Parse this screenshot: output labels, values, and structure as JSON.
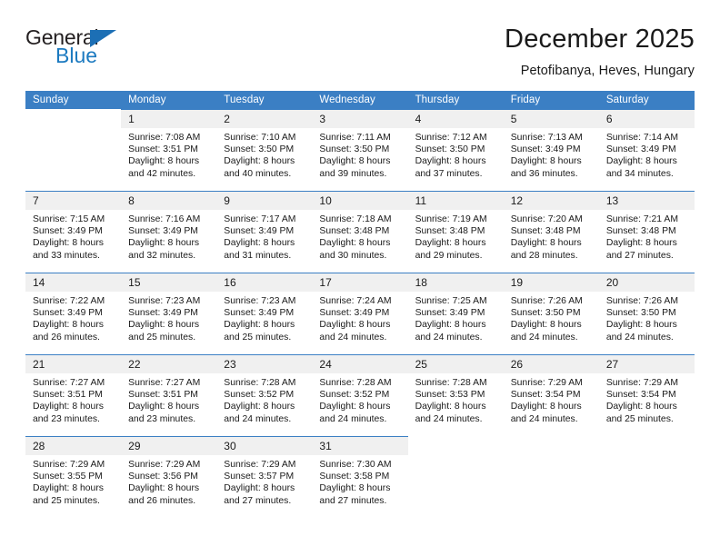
{
  "logo": {
    "word_primary": "General",
    "word_secondary": "Blue",
    "triangle_color": "#1c6fb5",
    "primary_color": "#231f20",
    "secondary_color": "#1c7ac0"
  },
  "header": {
    "month_title": "December 2025",
    "location": "Petofibanya, Heves, Hungary"
  },
  "theme": {
    "header_bg": "#3b7fc4",
    "header_text": "#ffffff",
    "daynum_bg": "#f0f0f0",
    "cell_bg": "#ffffff",
    "text": "#1a1a1a"
  },
  "weekday_headers": [
    "Sunday",
    "Monday",
    "Tuesday",
    "Wednesday",
    "Thursday",
    "Friday",
    "Saturday"
  ],
  "weeks": [
    [
      {
        "empty": true
      },
      {
        "day": "1",
        "sunrise": "Sunrise: 7:08 AM",
        "sunset": "Sunset: 3:51 PM",
        "daylight_1": "Daylight: 8 hours",
        "daylight_2": "and 42 minutes."
      },
      {
        "day": "2",
        "sunrise": "Sunrise: 7:10 AM",
        "sunset": "Sunset: 3:50 PM",
        "daylight_1": "Daylight: 8 hours",
        "daylight_2": "and 40 minutes."
      },
      {
        "day": "3",
        "sunrise": "Sunrise: 7:11 AM",
        "sunset": "Sunset: 3:50 PM",
        "daylight_1": "Daylight: 8 hours",
        "daylight_2": "and 39 minutes."
      },
      {
        "day": "4",
        "sunrise": "Sunrise: 7:12 AM",
        "sunset": "Sunset: 3:50 PM",
        "daylight_1": "Daylight: 8 hours",
        "daylight_2": "and 37 minutes."
      },
      {
        "day": "5",
        "sunrise": "Sunrise: 7:13 AM",
        "sunset": "Sunset: 3:49 PM",
        "daylight_1": "Daylight: 8 hours",
        "daylight_2": "and 36 minutes."
      },
      {
        "day": "6",
        "sunrise": "Sunrise: 7:14 AM",
        "sunset": "Sunset: 3:49 PM",
        "daylight_1": "Daylight: 8 hours",
        "daylight_2": "and 34 minutes."
      }
    ],
    [
      {
        "day": "7",
        "sunrise": "Sunrise: 7:15 AM",
        "sunset": "Sunset: 3:49 PM",
        "daylight_1": "Daylight: 8 hours",
        "daylight_2": "and 33 minutes."
      },
      {
        "day": "8",
        "sunrise": "Sunrise: 7:16 AM",
        "sunset": "Sunset: 3:49 PM",
        "daylight_1": "Daylight: 8 hours",
        "daylight_2": "and 32 minutes."
      },
      {
        "day": "9",
        "sunrise": "Sunrise: 7:17 AM",
        "sunset": "Sunset: 3:49 PM",
        "daylight_1": "Daylight: 8 hours",
        "daylight_2": "and 31 minutes."
      },
      {
        "day": "10",
        "sunrise": "Sunrise: 7:18 AM",
        "sunset": "Sunset: 3:48 PM",
        "daylight_1": "Daylight: 8 hours",
        "daylight_2": "and 30 minutes."
      },
      {
        "day": "11",
        "sunrise": "Sunrise: 7:19 AM",
        "sunset": "Sunset: 3:48 PM",
        "daylight_1": "Daylight: 8 hours",
        "daylight_2": "and 29 minutes."
      },
      {
        "day": "12",
        "sunrise": "Sunrise: 7:20 AM",
        "sunset": "Sunset: 3:48 PM",
        "daylight_1": "Daylight: 8 hours",
        "daylight_2": "and 28 minutes."
      },
      {
        "day": "13",
        "sunrise": "Sunrise: 7:21 AM",
        "sunset": "Sunset: 3:48 PM",
        "daylight_1": "Daylight: 8 hours",
        "daylight_2": "and 27 minutes."
      }
    ],
    [
      {
        "day": "14",
        "sunrise": "Sunrise: 7:22 AM",
        "sunset": "Sunset: 3:49 PM",
        "daylight_1": "Daylight: 8 hours",
        "daylight_2": "and 26 minutes."
      },
      {
        "day": "15",
        "sunrise": "Sunrise: 7:23 AM",
        "sunset": "Sunset: 3:49 PM",
        "daylight_1": "Daylight: 8 hours",
        "daylight_2": "and 25 minutes."
      },
      {
        "day": "16",
        "sunrise": "Sunrise: 7:23 AM",
        "sunset": "Sunset: 3:49 PM",
        "daylight_1": "Daylight: 8 hours",
        "daylight_2": "and 25 minutes."
      },
      {
        "day": "17",
        "sunrise": "Sunrise: 7:24 AM",
        "sunset": "Sunset: 3:49 PM",
        "daylight_1": "Daylight: 8 hours",
        "daylight_2": "and 24 minutes."
      },
      {
        "day": "18",
        "sunrise": "Sunrise: 7:25 AM",
        "sunset": "Sunset: 3:49 PM",
        "daylight_1": "Daylight: 8 hours",
        "daylight_2": "and 24 minutes."
      },
      {
        "day": "19",
        "sunrise": "Sunrise: 7:26 AM",
        "sunset": "Sunset: 3:50 PM",
        "daylight_1": "Daylight: 8 hours",
        "daylight_2": "and 24 minutes."
      },
      {
        "day": "20",
        "sunrise": "Sunrise: 7:26 AM",
        "sunset": "Sunset: 3:50 PM",
        "daylight_1": "Daylight: 8 hours",
        "daylight_2": "and 24 minutes."
      }
    ],
    [
      {
        "day": "21",
        "sunrise": "Sunrise: 7:27 AM",
        "sunset": "Sunset: 3:51 PM",
        "daylight_1": "Daylight: 8 hours",
        "daylight_2": "and 23 minutes."
      },
      {
        "day": "22",
        "sunrise": "Sunrise: 7:27 AM",
        "sunset": "Sunset: 3:51 PM",
        "daylight_1": "Daylight: 8 hours",
        "daylight_2": "and 23 minutes."
      },
      {
        "day": "23",
        "sunrise": "Sunrise: 7:28 AM",
        "sunset": "Sunset: 3:52 PM",
        "daylight_1": "Daylight: 8 hours",
        "daylight_2": "and 24 minutes."
      },
      {
        "day": "24",
        "sunrise": "Sunrise: 7:28 AM",
        "sunset": "Sunset: 3:52 PM",
        "daylight_1": "Daylight: 8 hours",
        "daylight_2": "and 24 minutes."
      },
      {
        "day": "25",
        "sunrise": "Sunrise: 7:28 AM",
        "sunset": "Sunset: 3:53 PM",
        "daylight_1": "Daylight: 8 hours",
        "daylight_2": "and 24 minutes."
      },
      {
        "day": "26",
        "sunrise": "Sunrise: 7:29 AM",
        "sunset": "Sunset: 3:54 PM",
        "daylight_1": "Daylight: 8 hours",
        "daylight_2": "and 24 minutes."
      },
      {
        "day": "27",
        "sunrise": "Sunrise: 7:29 AM",
        "sunset": "Sunset: 3:54 PM",
        "daylight_1": "Daylight: 8 hours",
        "daylight_2": "and 25 minutes."
      }
    ],
    [
      {
        "day": "28",
        "sunrise": "Sunrise: 7:29 AM",
        "sunset": "Sunset: 3:55 PM",
        "daylight_1": "Daylight: 8 hours",
        "daylight_2": "and 25 minutes."
      },
      {
        "day": "29",
        "sunrise": "Sunrise: 7:29 AM",
        "sunset": "Sunset: 3:56 PM",
        "daylight_1": "Daylight: 8 hours",
        "daylight_2": "and 26 minutes."
      },
      {
        "day": "30",
        "sunrise": "Sunrise: 7:29 AM",
        "sunset": "Sunset: 3:57 PM",
        "daylight_1": "Daylight: 8 hours",
        "daylight_2": "and 27 minutes."
      },
      {
        "day": "31",
        "sunrise": "Sunrise: 7:30 AM",
        "sunset": "Sunset: 3:58 PM",
        "daylight_1": "Daylight: 8 hours",
        "daylight_2": "and 27 minutes."
      },
      {
        "empty": true
      },
      {
        "empty": true
      },
      {
        "empty": true
      }
    ]
  ]
}
